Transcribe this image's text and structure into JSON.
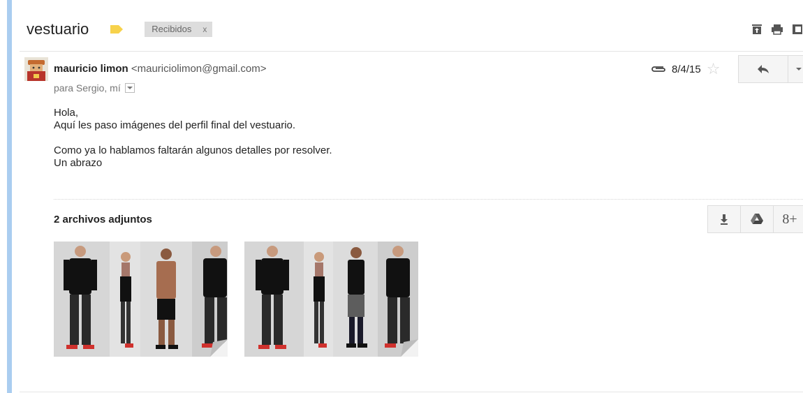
{
  "thread": {
    "subject": "vestuario",
    "label": "Recibidos",
    "label_remove": "x"
  },
  "message": {
    "sender_name": "mauricio limon",
    "sender_email": "<mauriciolimon@gmail.com>",
    "recipients": "para Sergio, mí",
    "date": "8/4/15",
    "body_lines": [
      "Hola,",
      "Aquí les paso imágenes del perfil final del vestuario.",
      "Como ya lo hablamos faltarán algunos detalles por resolver.",
      "Un abrazo"
    ]
  },
  "attachments": {
    "count_label": "2 archivos adjuntos",
    "google_plus_label": "8+"
  },
  "colors": {
    "accent_bar": "#aacdf0",
    "label_tag": "#f7d24b"
  },
  "icons": {
    "archive": "archive-icon",
    "print": "print-icon",
    "new_window": "new-window-icon",
    "paperclip": "paperclip-icon",
    "star": "star-icon",
    "reply": "reply-icon",
    "download": "download-icon",
    "drive": "drive-icon"
  }
}
